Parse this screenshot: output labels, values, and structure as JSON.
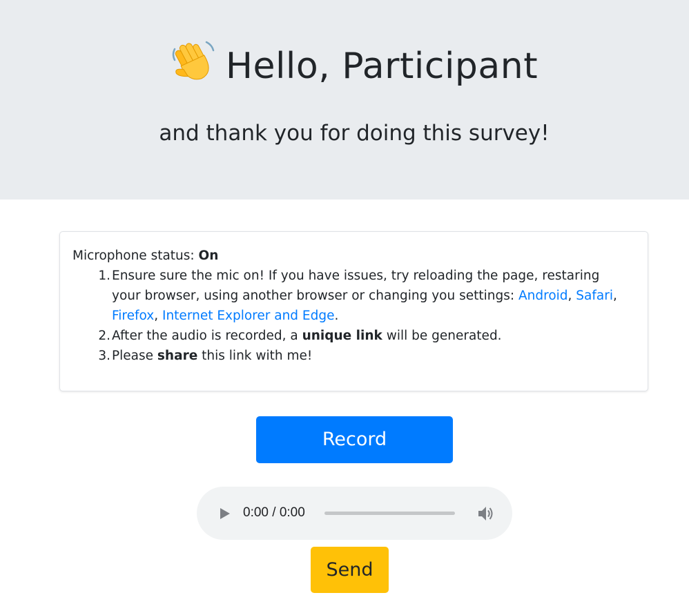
{
  "hero": {
    "wave_icon": "waving-hand-icon",
    "greeting": "Hello, Participant",
    "subtitle": "and thank you for doing this survey!"
  },
  "card": {
    "status_label": "Microphone status: ",
    "status_value": "On",
    "steps": [
      {
        "number": "1.",
        "text_before": "Ensure sure the mic on! If you have issues, try reloading the page, restaring your browser, using another browser or changing you settings: ",
        "links": [
          "Android",
          "Safari",
          "Firefox",
          "Internet Explorer and Edge"
        ],
        "separator": ", ",
        "end": "."
      },
      {
        "number": "2.",
        "text_before": "After the audio is recorded, a ",
        "bold": "unique link",
        "text_after": " will be generated."
      },
      {
        "number": "3.",
        "text_before": "Please ",
        "bold": "share",
        "text_after": " this link with me!"
      }
    ]
  },
  "record_button": {
    "label": "Record"
  },
  "audio_player": {
    "time": "0:00 / 0:00",
    "progress": 0,
    "play_icon": "play-icon",
    "volume_icon": "volume-icon"
  },
  "send_button": {
    "label": "Send"
  },
  "colors": {
    "jumbotron_bg": "#e9ecef",
    "primary": "#007bff",
    "warning": "#ffc107",
    "link": "#007bff"
  }
}
